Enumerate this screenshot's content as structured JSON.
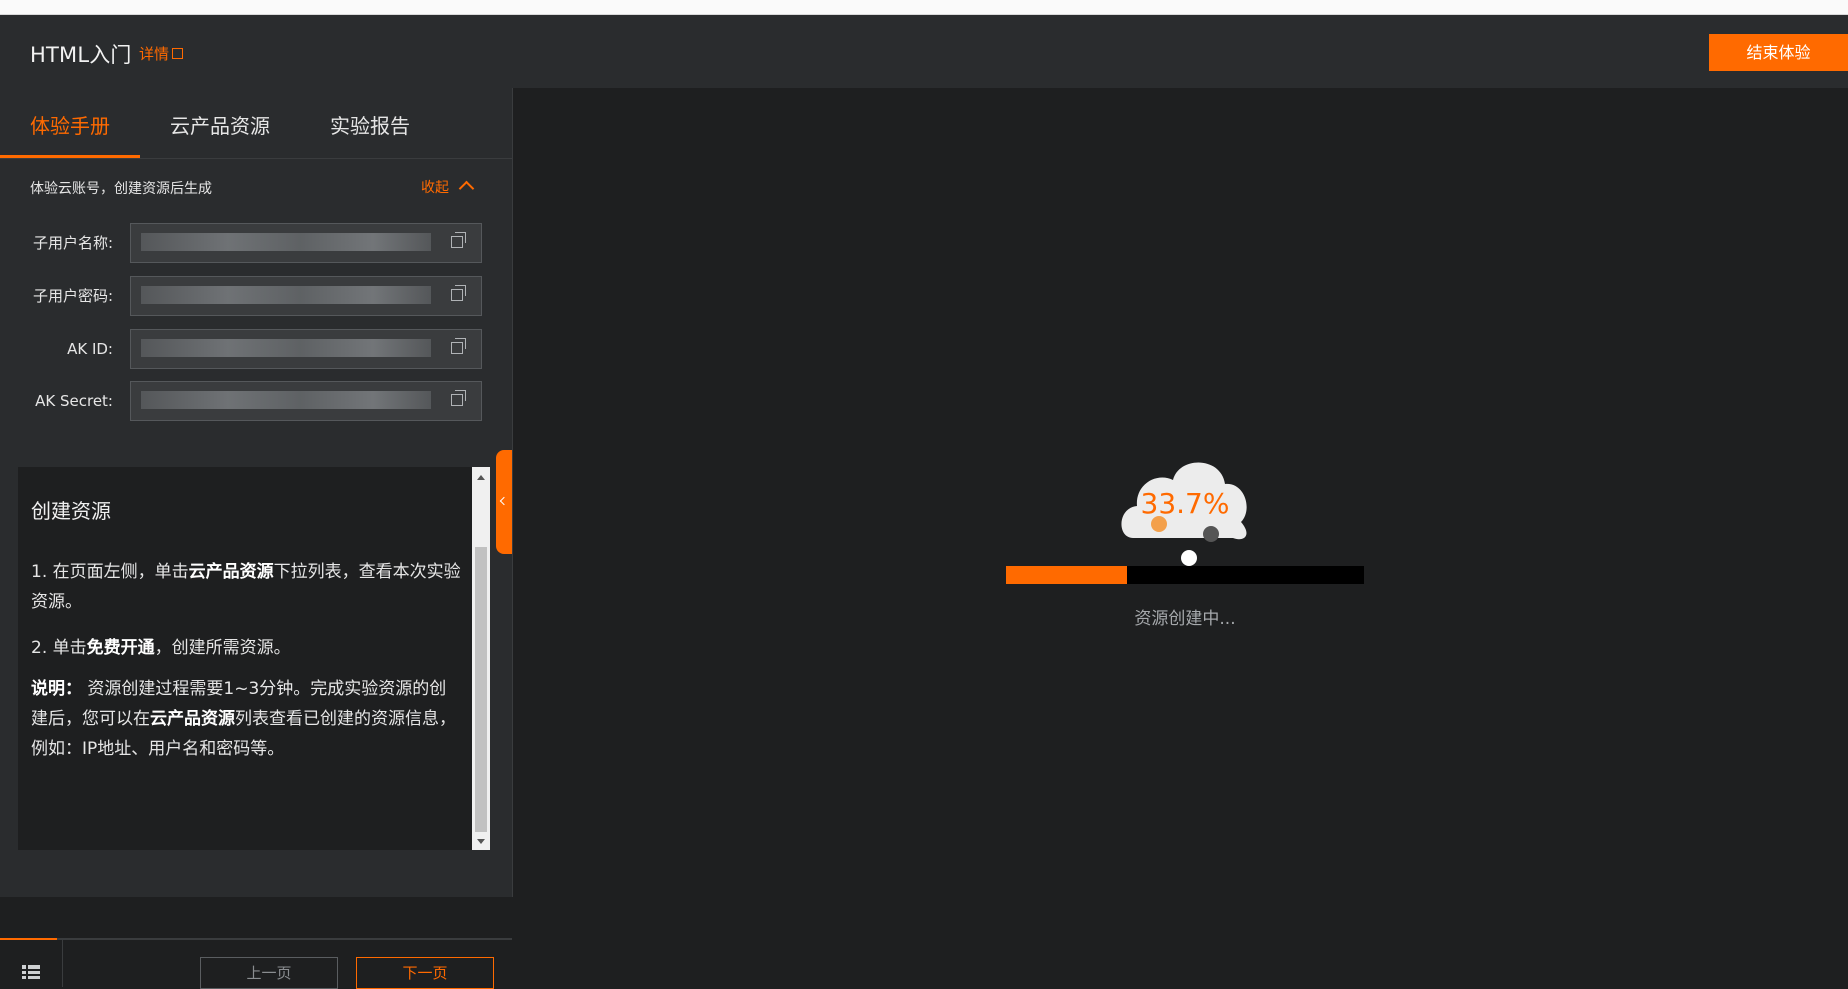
{
  "header": {
    "title": "HTML入门",
    "details_label": "详情",
    "end_button_label": "结束体验"
  },
  "sidebar": {
    "tabs": [
      {
        "label": "体验手册",
        "active": true
      },
      {
        "label": "云产品资源",
        "active": false
      },
      {
        "label": "实验报告",
        "active": false
      }
    ],
    "account": {
      "title": "体验云账号，创建资源后生成",
      "collapse_label": "收起",
      "fields": [
        {
          "label": "子用户名称:"
        },
        {
          "label": "子用户密码:"
        },
        {
          "label": "AK ID:"
        },
        {
          "label": "AK Secret:"
        }
      ]
    },
    "guide": {
      "heading": "创建资源",
      "step1_prefix": "1. 在页面左侧，单击",
      "step1_bold": "云产品资源",
      "step1_suffix": "下拉列表，查看本次实验资源。",
      "step2_prefix": "2. 单击",
      "step2_bold": "免费开通",
      "step2_suffix": "，创建所需资源。",
      "note_bold": "说明：",
      "note_text1": " 资源创建过程需要1~3分钟。完成实验资源的创建后，您可以在",
      "note_bold2": "云产品资源",
      "note_text2": "列表查看已创建的资源信息，例如：IP地址、用户名和密码等。"
    },
    "footer": {
      "prev_label": "上一页",
      "next_label": "下一页"
    }
  },
  "main": {
    "progress_text": "33.7%",
    "progress_value": 0.337,
    "status_text": "资源创建中..."
  },
  "colors": {
    "accent": "#ff6a00",
    "background": "#1e1f20",
    "panel": "#2a2c2e"
  },
  "icons": [
    "external-link-icon",
    "chevron-up-icon",
    "copy-icon",
    "collapse-handle-icon",
    "menu-grid-icon",
    "cloud-icon"
  ]
}
